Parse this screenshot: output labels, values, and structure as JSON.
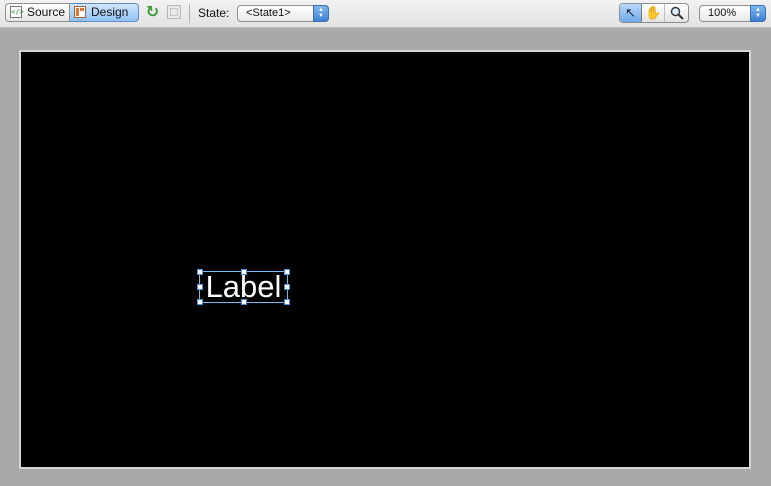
{
  "toolbar": {
    "source_label": "Source",
    "design_label": "Design",
    "state_label": "State:",
    "state_value": "<State1>",
    "zoom_value": "100%",
    "icons": {
      "source": "code-view-icon",
      "design": "design-view-icon",
      "refresh": "refresh-icon",
      "grid": "layout-grid-icon",
      "select_tool": "arrow-pointer-icon",
      "pan_tool": "hand-icon",
      "zoom_tool": "magnifier-icon"
    },
    "active_view": "design",
    "active_tool": "select"
  },
  "canvas": {
    "background": "#000000",
    "label_text": "Label",
    "label_color": "#ffffff",
    "selection_color": "#7ab8f0"
  },
  "colors": {
    "workspace": "#a9a9a9",
    "accent": "#6ea9ea"
  }
}
